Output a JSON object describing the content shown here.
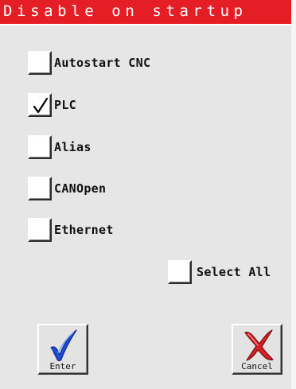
{
  "title": "Disable on startup",
  "options": [
    {
      "label": "Autostart CNC",
      "checked": false
    },
    {
      "label": "PLC",
      "checked": true
    },
    {
      "label": "Alias",
      "checked": false
    },
    {
      "label": "CANOpen",
      "checked": false
    },
    {
      "label": "Ethernet",
      "checked": false
    }
  ],
  "select_all": {
    "label": "Select All",
    "checked": false
  },
  "buttons": {
    "enter": {
      "label": "Enter",
      "icon": "checkmark-icon"
    },
    "cancel": {
      "label": "Cancel",
      "icon": "x-icon"
    }
  },
  "colors": {
    "title_bar": "#e51d25",
    "background": "#e6e6e6",
    "enter_icon": "#1e4fd6",
    "cancel_icon": "#d81f26"
  }
}
